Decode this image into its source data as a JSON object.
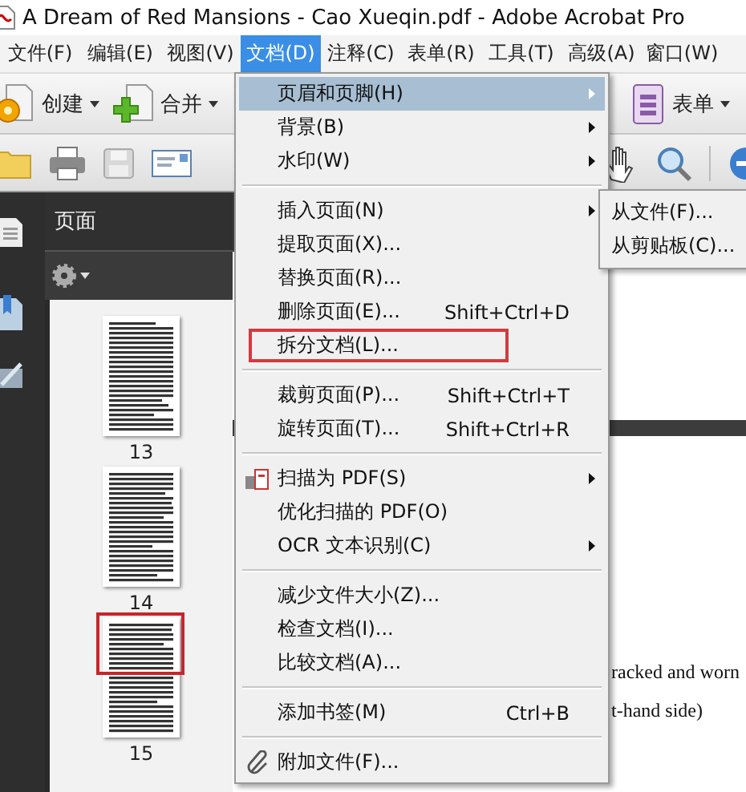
{
  "window": {
    "title": "A Dream of Red Mansions - Cao Xueqin.pdf - Adobe Acrobat Pro"
  },
  "menu_bar": [
    {
      "label": "文件(F)",
      "selected": false
    },
    {
      "label": "编辑(E)",
      "selected": false
    },
    {
      "label": "视图(V)",
      "selected": false
    },
    {
      "label": "文档(D)",
      "selected": true
    },
    {
      "label": "注释(C)",
      "selected": false
    },
    {
      "label": "表单(R)",
      "selected": false
    },
    {
      "label": "工具(T)",
      "selected": false
    },
    {
      "label": "高级(A)",
      "selected": false
    },
    {
      "label": "窗口(W)",
      "selected": false
    }
  ],
  "toolbar": [
    {
      "label": "创建",
      "kind": "create"
    },
    {
      "label": "合并",
      "kind": "combine"
    },
    {
      "label": "表单",
      "kind": "forms"
    }
  ],
  "navigation_panel": {
    "title": "页面",
    "thumbnails": [
      {
        "page": "13",
        "outlined": false
      },
      {
        "page": "14",
        "outlined": false
      },
      {
        "page": "15",
        "outlined": true
      }
    ]
  },
  "document": {
    "lines": [
      "racked and worn",
      "t-hand side)"
    ]
  },
  "dropdown_menu": {
    "items": [
      {
        "kind": "item",
        "label": "页眉和页脚(H)",
        "has_submenu": true,
        "highlighted": true,
        "outlined": false
      },
      {
        "kind": "item",
        "label": "背景(B)",
        "has_submenu": true,
        "highlighted": false,
        "outlined": false
      },
      {
        "kind": "item",
        "label": "水印(W)",
        "has_submenu": true,
        "highlighted": false,
        "outlined": false
      },
      {
        "kind": "separator"
      },
      {
        "kind": "item",
        "label": "插入页面(N)",
        "has_submenu": true,
        "highlighted": false,
        "outlined": false
      },
      {
        "kind": "item",
        "label": "提取页面(X)...",
        "has_submenu": false,
        "highlighted": false,
        "outlined": false
      },
      {
        "kind": "item",
        "label": "替换页面(R)...",
        "has_submenu": false,
        "highlighted": false,
        "outlined": false
      },
      {
        "kind": "item",
        "label": "删除页面(E)...",
        "shortcut": "Shift+Ctrl+D",
        "has_submenu": false,
        "highlighted": false,
        "outlined": false
      },
      {
        "kind": "item",
        "label": "拆分文档(L)...",
        "has_submenu": false,
        "highlighted": false,
        "outlined": true
      },
      {
        "kind": "separator"
      },
      {
        "kind": "item",
        "label": "裁剪页面(P)...",
        "shortcut": "Shift+Ctrl+T",
        "has_submenu": false,
        "highlighted": false,
        "outlined": false
      },
      {
        "kind": "item",
        "label": "旋转页面(T)...",
        "shortcut": "Shift+Ctrl+R",
        "has_submenu": false,
        "highlighted": false,
        "outlined": false
      },
      {
        "kind": "separator"
      },
      {
        "kind": "scan",
        "label": "扫描为 PDF(S)",
        "has_submenu": true,
        "highlighted": false,
        "outlined": false
      },
      {
        "kind": "item",
        "label": "优化扫描的 PDF(O)",
        "has_submenu": false,
        "highlighted": false,
        "outlined": false
      },
      {
        "kind": "item",
        "label": "OCR 文本识别(C)",
        "has_submenu": true,
        "highlighted": false,
        "outlined": false
      },
      {
        "kind": "separator"
      },
      {
        "kind": "item",
        "label": "减少文件大小(Z)...",
        "has_submenu": false,
        "highlighted": false,
        "outlined": false
      },
      {
        "kind": "item",
        "label": "检查文档(I)...",
        "has_submenu": false,
        "highlighted": false,
        "outlined": false
      },
      {
        "kind": "item",
        "label": "比较文档(A)...",
        "has_submenu": false,
        "highlighted": false,
        "outlined": false
      },
      {
        "kind": "separator"
      },
      {
        "kind": "item",
        "label": "添加书签(M)",
        "shortcut": "Ctrl+B",
        "has_submenu": false,
        "highlighted": false,
        "outlined": false
      },
      {
        "kind": "separator"
      },
      {
        "kind": "attach",
        "label": "附加文件(F)...",
        "has_submenu": false,
        "highlighted": false,
        "outlined": false
      }
    ]
  },
  "submenu": {
    "items": [
      {
        "label": "从文件(F)..."
      },
      {
        "label": "从剪贴板(C)..."
      }
    ]
  }
}
